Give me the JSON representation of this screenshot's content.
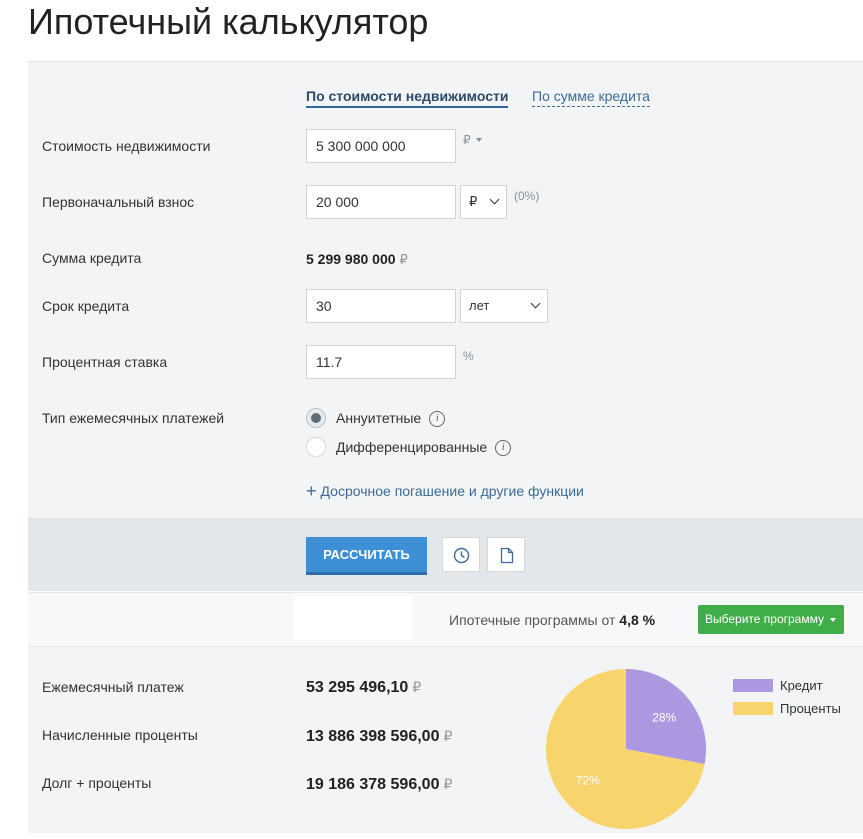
{
  "page": {
    "title": "Ипотечный калькулятор"
  },
  "tabs": {
    "active": "По стоимости недвижимости",
    "inactive": "По сумме кредита"
  },
  "form": {
    "property_cost": {
      "label": "Стоимость недвижимости",
      "value": "5 300 000 000",
      "currency": "₽"
    },
    "down_payment": {
      "label": "Первоначальный взнос",
      "value": "20 000",
      "unit": "₽",
      "percent": "(0%)"
    },
    "loan_amount": {
      "label": "Сумма кредита",
      "value": "5 299 980 000",
      "currency": "₽"
    },
    "term": {
      "label": "Срок кредита",
      "value": "30",
      "unit": "лет"
    },
    "rate": {
      "label": "Процентная ставка",
      "value": "11.7",
      "unit": "%"
    },
    "payment_type": {
      "label": "Тип ежемесячных платежей",
      "options": [
        {
          "label": "Аннуитетные",
          "selected": true
        },
        {
          "label": "Дифференцированные",
          "selected": false
        }
      ]
    },
    "more_link": "Досрочное погашение и другие функции"
  },
  "actions": {
    "calculate": "РАССЧИТАТЬ",
    "history_icon": "clock-icon",
    "document_icon": "document-icon"
  },
  "promo": {
    "text": "Ипотечные программы от",
    "rate": "4,8 %",
    "button": "Выберите программу"
  },
  "results": {
    "monthly_payment": {
      "label": "Ежемесячный платеж",
      "value": "53 295 496,10",
      "currency": "₽"
    },
    "interest": {
      "label": "Начисленные проценты",
      "value": "13 886 398 596,00",
      "currency": "₽"
    },
    "total": {
      "label": "Долг + проценты",
      "value": "19 186 378 596,00",
      "currency": "₽"
    }
  },
  "chart_data": {
    "type": "pie",
    "title": "",
    "series": [
      {
        "name": "Кредит",
        "value": 28,
        "label": "28%",
        "color": "#ab98e0"
      },
      {
        "name": "Проценты",
        "value": 72,
        "label": "72%",
        "color": "#f7d56c"
      }
    ],
    "legend_placement": "right"
  },
  "colors": {
    "accent": "#3d8fd6",
    "green": "#3fae49",
    "panel": "#f2f4f5"
  }
}
